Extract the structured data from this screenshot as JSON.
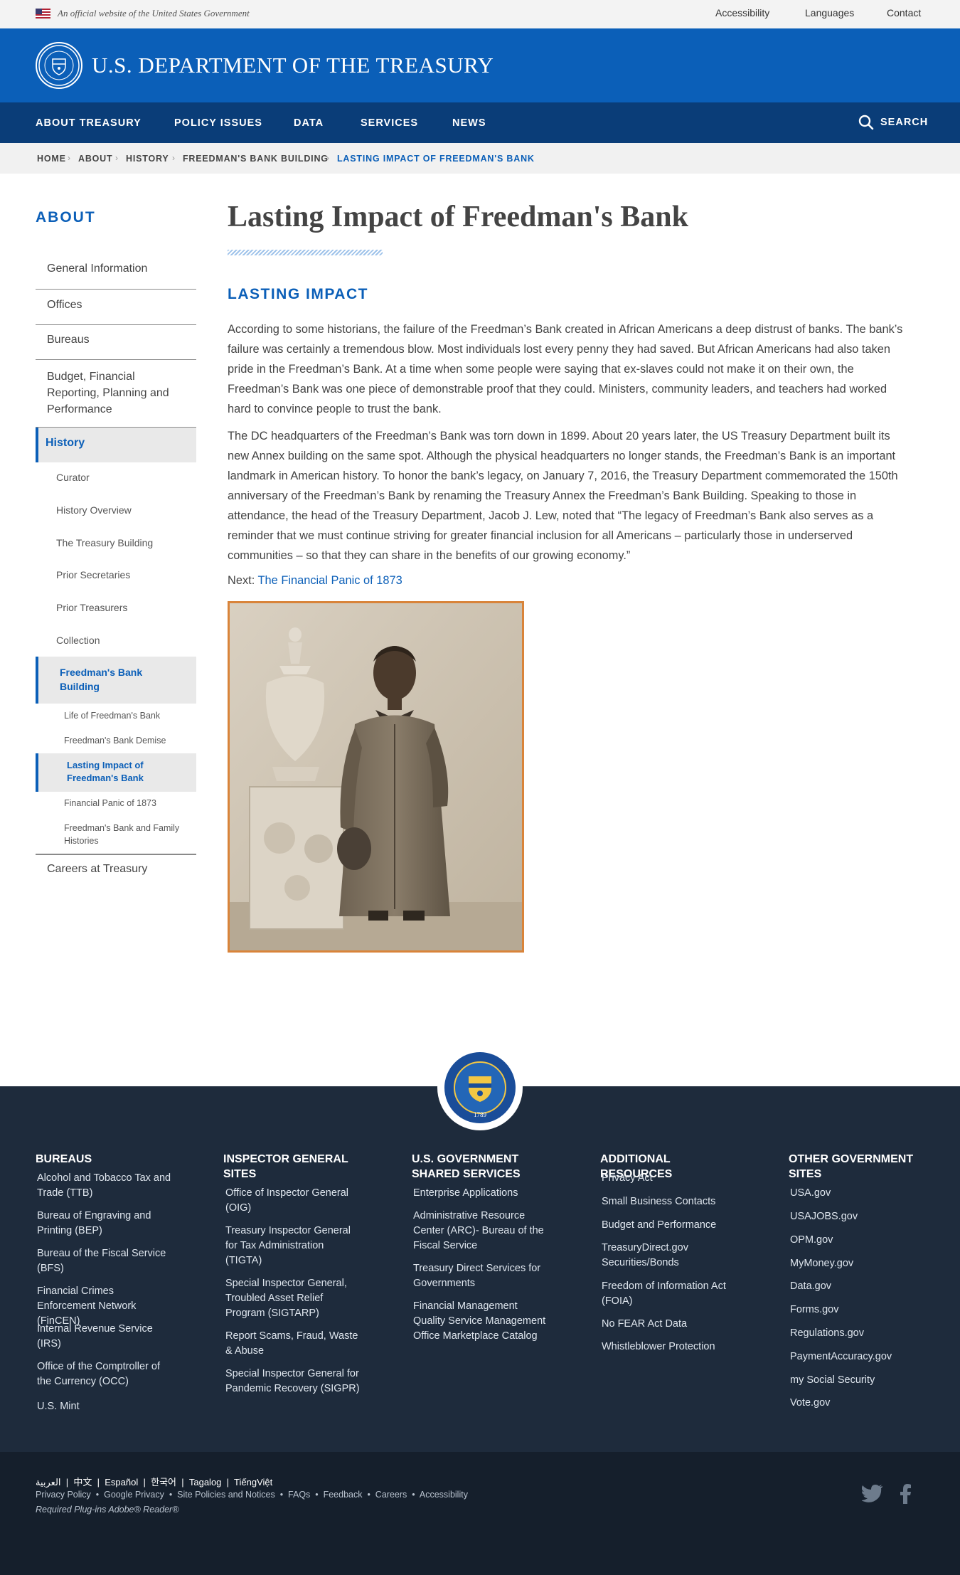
{
  "banner": {
    "official_text": "An official website of the United States Government",
    "links": [
      "Accessibility",
      "Languages",
      "Contact"
    ]
  },
  "header": {
    "title": "U.S. DEPARTMENT OF THE TREASURY"
  },
  "nav": {
    "items": [
      "ABOUT TREASURY",
      "POLICY ISSUES",
      "DATA",
      "SERVICES",
      "NEWS"
    ],
    "search_label": "SEARCH"
  },
  "breadcrumb": [
    "HOME",
    "ABOUT",
    "HISTORY",
    "FREEDMAN'S BANK BUILDING",
    "LASTING IMPACT OF FREEDMAN'S BANK"
  ],
  "sidebar": {
    "title": "ABOUT",
    "items": [
      "General Information",
      "Offices",
      "Bureaus",
      "Budget, Financial Reporting, Planning and Performance"
    ],
    "history_label": "History",
    "history_sub": [
      "Curator",
      "History Overview",
      "The Treasury Building",
      "Prior Secretaries",
      "Prior Treasurers",
      "Collection"
    ],
    "freedmans_label": "Freedman's Bank Building",
    "freedmans_sub": [
      "Life of Freedman's Bank",
      "Freedman's Bank Demise"
    ],
    "current_label": "Lasting Impact of Freedman's Bank",
    "freedmans_sub_after": [
      "Financial Panic of 1873",
      "Freedman's Bank and Family Histories"
    ],
    "careers": "Careers at Treasury"
  },
  "main": {
    "title": "Lasting Impact of Freedman's Bank",
    "heading": "LASTING IMPACT",
    "paragraph1": "According to some historians, the failure of the Freedman’s Bank created in African Americans a deep distrust of banks. The bank’s failure was certainly a tremendous blow. Most individuals lost every penny they had saved. But African Americans had also taken pride in the Freedman’s Bank. At a time when some people were saying that ex-slaves could not make it on their own, the Freedman’s Bank was one piece of demonstrable proof that they could. Ministers, community leaders, and teachers had worked hard to convince people to trust the bank.",
    "paragraph2": "The DC headquarters of the Freedman’s Bank was torn down in 1899. About 20 years later, the US Treasury Department built its new Annex building on the same spot. Although the physical headquarters no longer stands, the Freedman’s Bank is an important landmark in American history. To honor the bank’s legacy, on January 7, 2016, the Treasury Department commemorated the 150th anniversary of the Freedman’s Bank by renaming the Treasury Annex the Freedman’s Bank Building. Speaking to those in attendance, the head of the Treasury Department, Jacob J. Lew, noted that “The legacy of Freedman’s Bank also serves as a reminder that we must continue striving for greater financial inclusion for all Americans – particularly those in underserved communities – so that they can share in the benefits of our growing economy.”",
    "next_prefix": "Next:",
    "next_link": "The Financial Panic of 1873"
  },
  "footer": {
    "seal_year": "1789",
    "columns": [
      {
        "heading": "BUREAUS",
        "links": [
          "Alcohol and Tobacco Tax and Trade (TTB)",
          "Bureau of Engraving and Printing (BEP)",
          "Bureau of the Fiscal Service (BFS)",
          "Financial Crimes Enforcement Network (FinCEN)",
          "Internal Revenue Service (IRS)",
          "Office of the Comptroller of the Currency (OCC)",
          "U.S. Mint"
        ]
      },
      {
        "heading": "INSPECTOR GENERAL SITES",
        "links": [
          "Office of Inspector General (OIG)",
          "Treasury Inspector General for Tax Administration (TIGTA)",
          "Special Inspector General, Troubled Asset Relief Program (SIGTARP)",
          "Report Scams, Fraud, Waste & Abuse",
          "Special Inspector General for Pandemic Recovery (SIGPR)"
        ]
      },
      {
        "heading": "U.S. GOVERNMENT SHARED SERVICES",
        "links": [
          "Enterprise Applications",
          "Administrative Resource Center (ARC)- Bureau of the Fiscal Service",
          "Treasury Direct Services for Governments",
          "Financial Management Quality Service Management Office Marketplace Catalog"
        ]
      },
      {
        "heading": "ADDITIONAL RESOURCES",
        "links": [
          "Privacy Act",
          "Small Business Contacts",
          "Budget and Performance",
          "TreasuryDirect.gov Securities/Bonds",
          "Freedom of Information Act (FOIA)",
          "No FEAR Act Data",
          "Whistleblower Protection"
        ]
      },
      {
        "heading": "OTHER GOVERNMENT SITES",
        "links": [
          "USA.gov",
          "USAJOBS.gov",
          "OPM.gov",
          "MyMoney.gov",
          "Data.gov",
          "Forms.gov",
          "Regulations.gov",
          "PaymentAccuracy.gov",
          "my Social Security",
          "Vote.gov"
        ]
      }
    ],
    "languages": [
      "العربية",
      "中文",
      "Español",
      "한국어",
      "Tagalog",
      "TiếngViệt"
    ],
    "legal": [
      "Privacy Policy",
      "Google Privacy",
      "Site Policies and Notices",
      "FAQs",
      "Feedback",
      "Careers",
      "Accessibility"
    ],
    "plugins": "Required Plug-ins  Adobe® Reader®",
    "social": [
      "twitter-icon",
      "facebook-icon"
    ]
  },
  "colors": {
    "primary_blue": "#0b5fb8",
    "nav_blue": "#0a3d78",
    "footer_bg": "#1e2b3c",
    "photo_border": "#d9843a"
  }
}
